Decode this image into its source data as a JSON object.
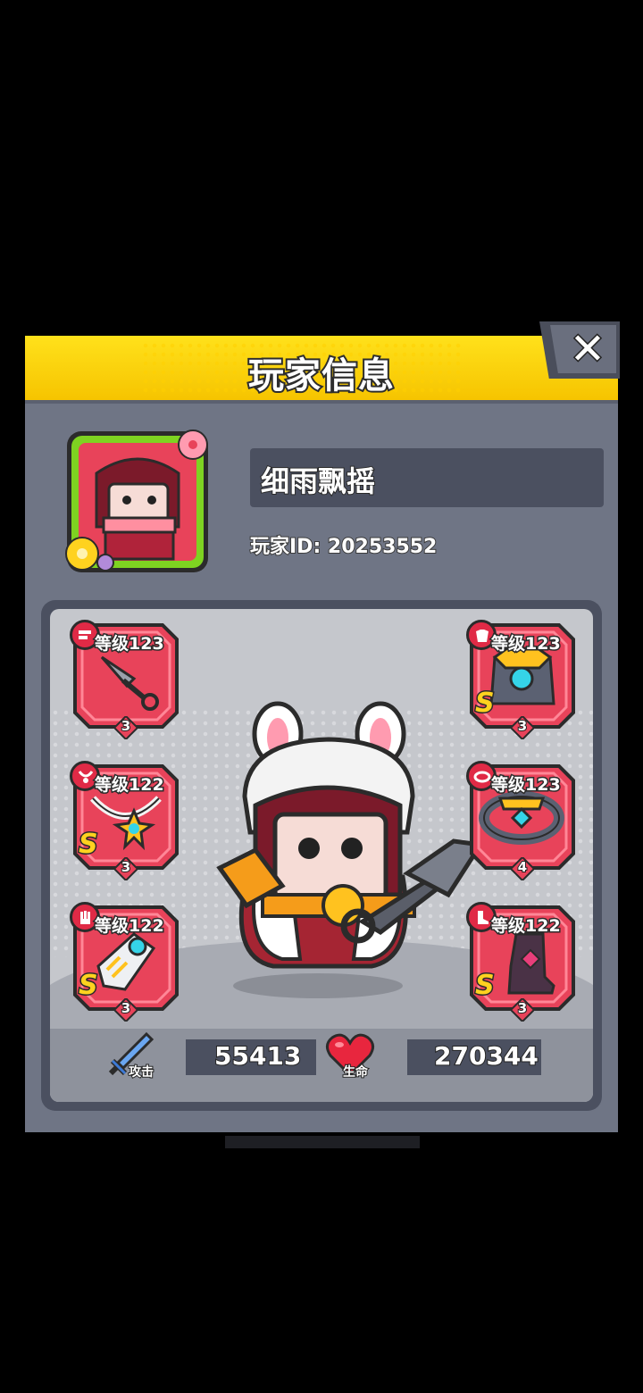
{
  "title": "玩家信息",
  "close_icon": "✕",
  "player": {
    "name": "细雨飘摇",
    "id_text": "玩家ID: 20253552"
  },
  "equipment": [
    {
      "slot": "weapon",
      "level_text": "等级123",
      "grade": "",
      "stars": "3",
      "icon": "kunai-icon"
    },
    {
      "slot": "armor",
      "level_text": "等级123",
      "grade": "S",
      "stars": "3",
      "icon": "armor-icon"
    },
    {
      "slot": "necklace",
      "level_text": "等级122",
      "grade": "S",
      "stars": "3",
      "icon": "necklace-icon"
    },
    {
      "slot": "belt",
      "level_text": "等级123",
      "grade": "",
      "stars": "4",
      "icon": "belt-icon"
    },
    {
      "slot": "gloves",
      "level_text": "等级122",
      "grade": "S",
      "stars": "3",
      "icon": "glove-icon"
    },
    {
      "slot": "boots",
      "level_text": "等级122",
      "grade": "S",
      "stars": "3",
      "icon": "boot-icon"
    }
  ],
  "stats": {
    "attack_label": "攻击",
    "attack_value": "55413",
    "hp_label": "生命",
    "hp_value": "270344"
  },
  "colors": {
    "header": "#ffd60a",
    "panel": "#6f7585",
    "slot_red": "#e8435a",
    "avatar_frame": "#7ed321"
  }
}
